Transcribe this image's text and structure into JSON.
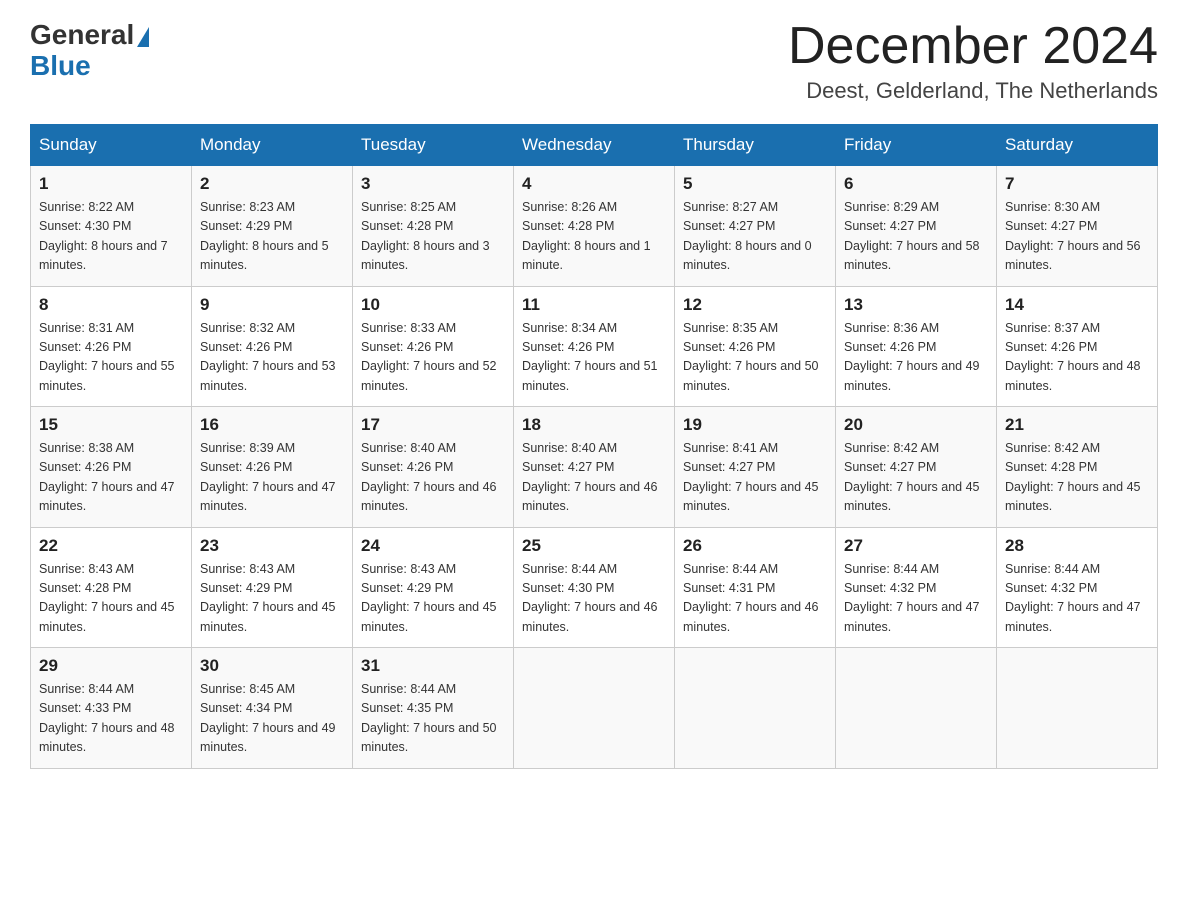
{
  "header": {
    "logo_general": "General",
    "logo_blue": "Blue",
    "month_title": "December 2024",
    "location": "Deest, Gelderland, The Netherlands"
  },
  "weekdays": [
    "Sunday",
    "Monday",
    "Tuesday",
    "Wednesday",
    "Thursday",
    "Friday",
    "Saturday"
  ],
  "weeks": [
    [
      {
        "day": "1",
        "sunrise": "8:22 AM",
        "sunset": "4:30 PM",
        "daylight": "8 hours and 7 minutes."
      },
      {
        "day": "2",
        "sunrise": "8:23 AM",
        "sunset": "4:29 PM",
        "daylight": "8 hours and 5 minutes."
      },
      {
        "day": "3",
        "sunrise": "8:25 AM",
        "sunset": "4:28 PM",
        "daylight": "8 hours and 3 minutes."
      },
      {
        "day": "4",
        "sunrise": "8:26 AM",
        "sunset": "4:28 PM",
        "daylight": "8 hours and 1 minute."
      },
      {
        "day": "5",
        "sunrise": "8:27 AM",
        "sunset": "4:27 PM",
        "daylight": "8 hours and 0 minutes."
      },
      {
        "day": "6",
        "sunrise": "8:29 AM",
        "sunset": "4:27 PM",
        "daylight": "7 hours and 58 minutes."
      },
      {
        "day": "7",
        "sunrise": "8:30 AM",
        "sunset": "4:27 PM",
        "daylight": "7 hours and 56 minutes."
      }
    ],
    [
      {
        "day": "8",
        "sunrise": "8:31 AM",
        "sunset": "4:26 PM",
        "daylight": "7 hours and 55 minutes."
      },
      {
        "day": "9",
        "sunrise": "8:32 AM",
        "sunset": "4:26 PM",
        "daylight": "7 hours and 53 minutes."
      },
      {
        "day": "10",
        "sunrise": "8:33 AM",
        "sunset": "4:26 PM",
        "daylight": "7 hours and 52 minutes."
      },
      {
        "day": "11",
        "sunrise": "8:34 AM",
        "sunset": "4:26 PM",
        "daylight": "7 hours and 51 minutes."
      },
      {
        "day": "12",
        "sunrise": "8:35 AM",
        "sunset": "4:26 PM",
        "daylight": "7 hours and 50 minutes."
      },
      {
        "day": "13",
        "sunrise": "8:36 AM",
        "sunset": "4:26 PM",
        "daylight": "7 hours and 49 minutes."
      },
      {
        "day": "14",
        "sunrise": "8:37 AM",
        "sunset": "4:26 PM",
        "daylight": "7 hours and 48 minutes."
      }
    ],
    [
      {
        "day": "15",
        "sunrise": "8:38 AM",
        "sunset": "4:26 PM",
        "daylight": "7 hours and 47 minutes."
      },
      {
        "day": "16",
        "sunrise": "8:39 AM",
        "sunset": "4:26 PM",
        "daylight": "7 hours and 47 minutes."
      },
      {
        "day": "17",
        "sunrise": "8:40 AM",
        "sunset": "4:26 PM",
        "daylight": "7 hours and 46 minutes."
      },
      {
        "day": "18",
        "sunrise": "8:40 AM",
        "sunset": "4:27 PM",
        "daylight": "7 hours and 46 minutes."
      },
      {
        "day": "19",
        "sunrise": "8:41 AM",
        "sunset": "4:27 PM",
        "daylight": "7 hours and 45 minutes."
      },
      {
        "day": "20",
        "sunrise": "8:42 AM",
        "sunset": "4:27 PM",
        "daylight": "7 hours and 45 minutes."
      },
      {
        "day": "21",
        "sunrise": "8:42 AM",
        "sunset": "4:28 PM",
        "daylight": "7 hours and 45 minutes."
      }
    ],
    [
      {
        "day": "22",
        "sunrise": "8:43 AM",
        "sunset": "4:28 PM",
        "daylight": "7 hours and 45 minutes."
      },
      {
        "day": "23",
        "sunrise": "8:43 AM",
        "sunset": "4:29 PM",
        "daylight": "7 hours and 45 minutes."
      },
      {
        "day": "24",
        "sunrise": "8:43 AM",
        "sunset": "4:29 PM",
        "daylight": "7 hours and 45 minutes."
      },
      {
        "day": "25",
        "sunrise": "8:44 AM",
        "sunset": "4:30 PM",
        "daylight": "7 hours and 46 minutes."
      },
      {
        "day": "26",
        "sunrise": "8:44 AM",
        "sunset": "4:31 PM",
        "daylight": "7 hours and 46 minutes."
      },
      {
        "day": "27",
        "sunrise": "8:44 AM",
        "sunset": "4:32 PM",
        "daylight": "7 hours and 47 minutes."
      },
      {
        "day": "28",
        "sunrise": "8:44 AM",
        "sunset": "4:32 PM",
        "daylight": "7 hours and 47 minutes."
      }
    ],
    [
      {
        "day": "29",
        "sunrise": "8:44 AM",
        "sunset": "4:33 PM",
        "daylight": "7 hours and 48 minutes."
      },
      {
        "day": "30",
        "sunrise": "8:45 AM",
        "sunset": "4:34 PM",
        "daylight": "7 hours and 49 minutes."
      },
      {
        "day": "31",
        "sunrise": "8:44 AM",
        "sunset": "4:35 PM",
        "daylight": "7 hours and 50 minutes."
      },
      null,
      null,
      null,
      null
    ]
  ],
  "labels": {
    "sunrise": "Sunrise:",
    "sunset": "Sunset:",
    "daylight": "Daylight:"
  }
}
